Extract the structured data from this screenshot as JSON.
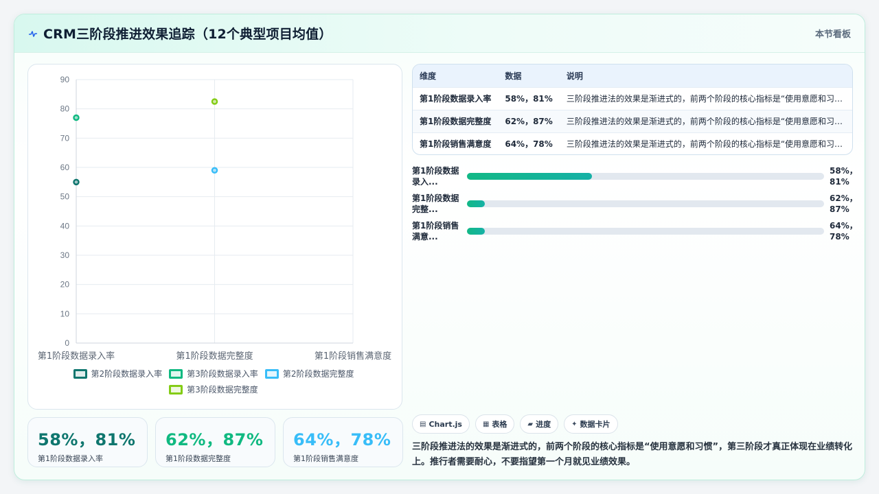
{
  "header": {
    "title": "CRM三阶段推进效果追踪（12个典型项目均值）",
    "right_label": "本节看板"
  },
  "colors": {
    "teal_dark": "#0f766e",
    "green": "#10b981",
    "sky": "#38bdf8",
    "lime": "#84cc16",
    "accent_green": "#12b886"
  },
  "chart_data": {
    "type": "scatter",
    "categories": [
      "第1阶段数据录入率",
      "第1阶段数据完整度",
      "第1阶段销售满意度"
    ],
    "ylim": [
      0,
      90
    ],
    "yticks": [
      0,
      10,
      20,
      30,
      40,
      50,
      60,
      70,
      80,
      90
    ],
    "grid": true,
    "legend_position": "bottom",
    "series": [
      {
        "name": "第2阶段数据录入率",
        "color": "#0f766e",
        "points": [
          {
            "x": "第1阶段数据录入率",
            "y": 55
          }
        ]
      },
      {
        "name": "第3阶段数据录入率",
        "color": "#10b981",
        "points": [
          {
            "x": "第1阶段数据录入率",
            "y": 77
          }
        ]
      },
      {
        "name": "第2阶段数据完整度",
        "color": "#38bdf8",
        "points": [
          {
            "x": "第1阶段数据完整度",
            "y": 59
          }
        ]
      },
      {
        "name": "第3阶段数据完整度",
        "color": "#84cc16",
        "points": [
          {
            "x": "第1阶段数据完整度",
            "y": 82.5
          }
        ]
      }
    ]
  },
  "stats": [
    {
      "value": "58%，81%",
      "label": "第1阶段数据录入率",
      "color": "#0f766e"
    },
    {
      "value": "62%，87%",
      "label": "第1阶段数据完整度",
      "color": "#10b981"
    },
    {
      "value": "64%，78%",
      "label": "第1阶段销售满意度",
      "color": "#38bdf8"
    }
  ],
  "table": {
    "headers": [
      "维度",
      "数据",
      "说明"
    ],
    "rows": [
      [
        "第1阶段数据录入率",
        "58%，81%",
        "三阶段推进法的效果是渐进式的，前两个阶段的核心指标是“使用意愿和习惯..."
      ],
      [
        "第1阶段数据完整度",
        "62%，87%",
        "三阶段推进法的效果是渐进式的，前两个阶段的核心指标是“使用意愿和习惯..."
      ],
      [
        "第1阶段销售满意度",
        "64%，78%",
        "三阶段推进法的效果是渐进式的，前两个阶段的核心指标是“使用意愿和习惯..."
      ]
    ]
  },
  "progress": [
    {
      "label": "第1阶段数据录入...",
      "value": "58%，81%",
      "fill": 0.35
    },
    {
      "label": "第1阶段数据完整...",
      "value": "62%，87%",
      "fill": 0.05
    },
    {
      "label": "第1阶段销售满意...",
      "value": "64%，78%",
      "fill": 0.05
    }
  ],
  "tags": [
    {
      "icon": "▤",
      "label": "Chart.js"
    },
    {
      "icon": "▦",
      "label": "表格"
    },
    {
      "icon": "▰",
      "label": "进度"
    },
    {
      "icon": "✦",
      "label": "数据卡片"
    }
  ],
  "summary": "三阶段推进法的效果是渐进式的，前两个阶段的核心指标是“使用意愿和习惯”，第三阶段才真正体现在业绩转化上。推行者需要耐心，不要指望第一个月就见业绩效果。"
}
